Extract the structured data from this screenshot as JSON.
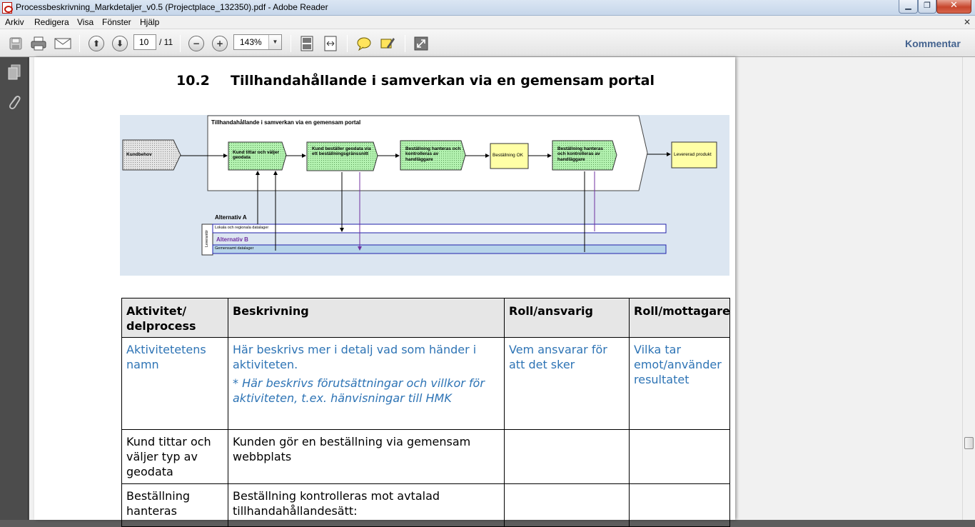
{
  "window": {
    "title": "Processbeskrivning_Markdetaljer_v0.5 (Projectplace_132350).pdf - Adobe Reader"
  },
  "menu": [
    "Arkiv",
    "Redigera",
    "Visa",
    "Fönster",
    "Hjälp"
  ],
  "toolbar": {
    "page_current": "10",
    "page_total": "/ 11",
    "zoom": "143%",
    "comment_label": "Kommentar"
  },
  "document": {
    "section_number": "10.2",
    "section_title": "Tillhandahållande i samverkan via en gemensam portal",
    "diagram": {
      "frame_title": "Tillhandahållande i samverkan via en gemensam portal",
      "kundbehov": "Kundbehov",
      "step1": "Kund tittar och väljer geodata",
      "step2": "Kund beställer geodata via ett beställningsgränssnitt",
      "step3": "Beställning hanteras och kontrolleras av handläggare",
      "step4": "Beställning OK",
      "step5": "Beställning hanteras och kontrolleras av handläggare",
      "step6": "Levererad produkt",
      "alt_a": "Alternativ A",
      "alt_b": "Alternativ B",
      "lane1": "Lokala och regionala datalager",
      "lane2": "Gemensamt datalager",
      "lane_side": "Leverantör"
    },
    "table": {
      "headers": [
        "Aktivitet/ delprocess",
        "Beskrivning",
        "Roll/ansvarig",
        "Roll/mottagare"
      ],
      "rows": [
        {
          "activity": "Aktivitetetens namn",
          "description": "Här beskrivs mer i detalj vad som händer i aktiviteten.",
          "note": "* Här beskrivs förutsättningar och villkor för aktiviteten, t.ex. hänvisningar till HMK",
          "responsible": "Vem ansvarar för att det sker",
          "receiver": "Vilka tar emot/använder resultatet"
        },
        {
          "activity": "Kund tittar och väljer typ av geodata",
          "description": "Kunden gör en beställning via gemensam webbplats",
          "responsible": "",
          "receiver": ""
        },
        {
          "activity": "Beställning hanteras",
          "description": "Beställning kontrolleras mot avtalad tillhandahållandesätt:",
          "responsible": "",
          "receiver": ""
        }
      ]
    }
  },
  "colors": {
    "diagram_bg": "#dce6f1",
    "green_step": "#b3f2b0",
    "yellow_step": "#ffffa6",
    "link_blue": "#2e74b5",
    "alt_b_purple": "#7030a0"
  }
}
